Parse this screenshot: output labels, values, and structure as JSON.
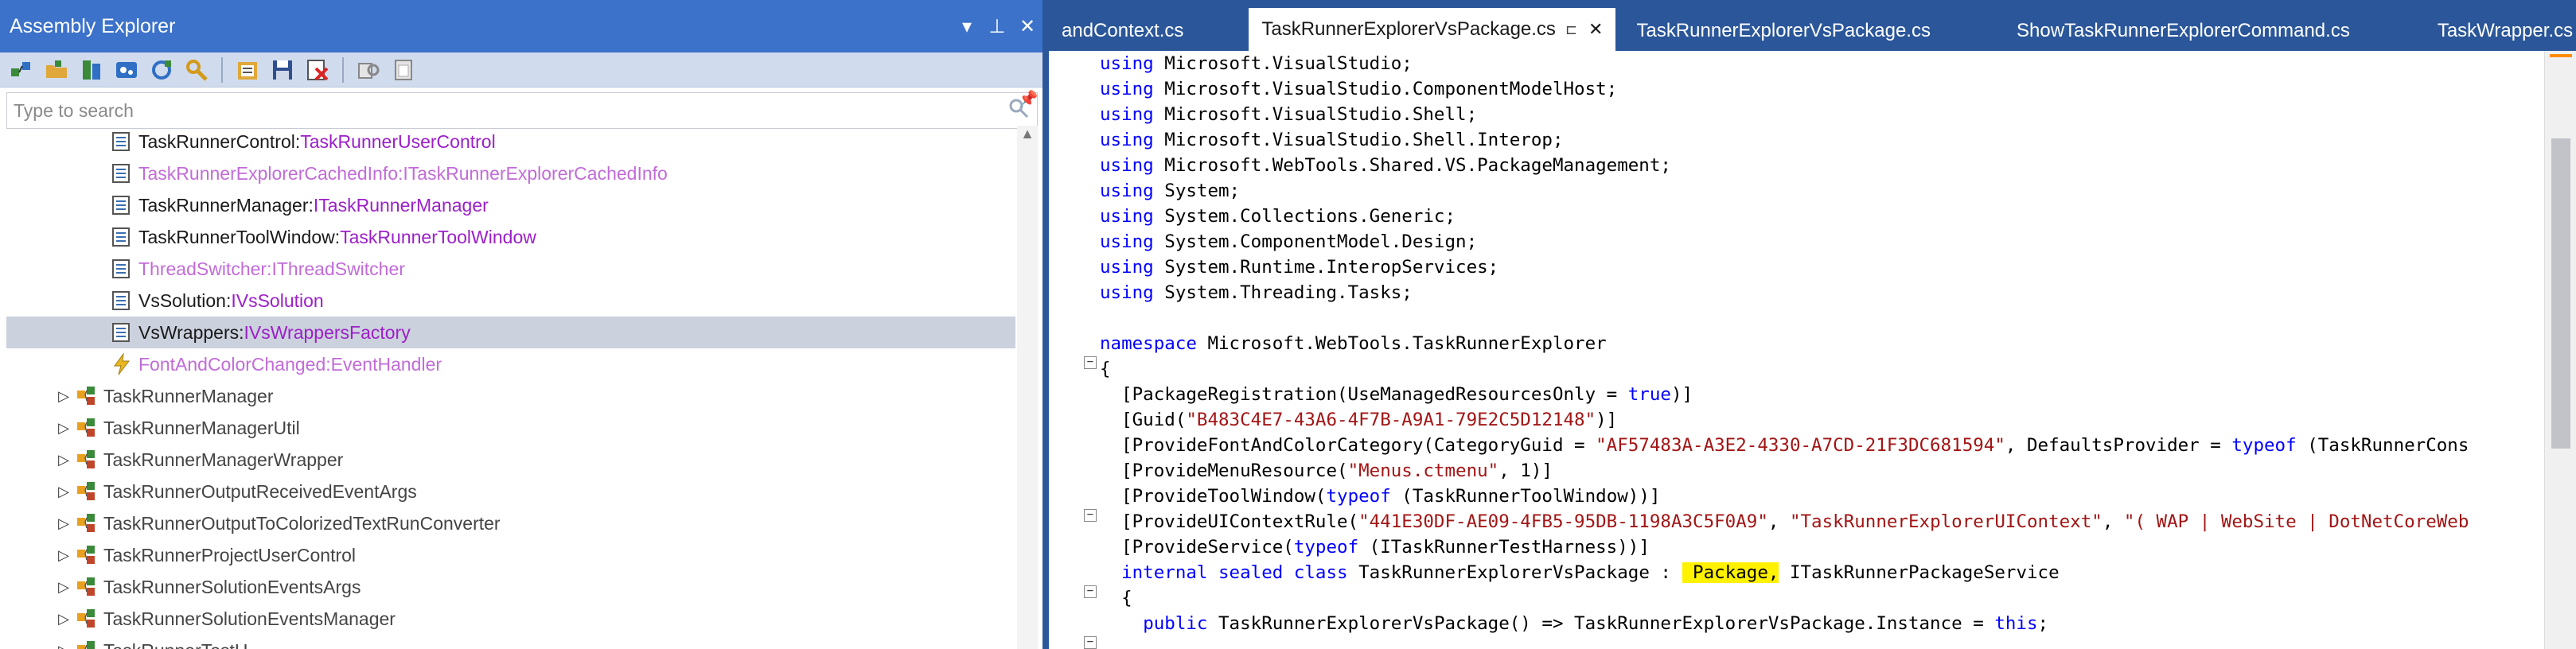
{
  "assembly_explorer": {
    "title": "Assembly Explorer",
    "title_controls": {
      "dropdown": "▾",
      "pin": "⊥",
      "close": "✕"
    },
    "toolbar_icons": [
      "open-assembly-icon",
      "open-folder-icon",
      "open-from-gac-icon",
      "open-nuget-icon",
      "sync-icon",
      "search-icon",
      "new-list-icon",
      "save-list-icon",
      "remove-icon",
      "copy-icon",
      "paste-icon"
    ],
    "search": {
      "placeholder": "Type to search"
    },
    "tree": [
      {
        "name": "TaskRunnerControl",
        "type": "TaskRunnerUserControl",
        "icon": "field-icon",
        "indent": 3,
        "style": "normal"
      },
      {
        "name": "TaskRunnerExplorerCachedInfo",
        "type": "ITaskRunnerExplorerCachedInfo",
        "icon": "field-icon",
        "indent": 3,
        "style": "fade"
      },
      {
        "name": "TaskRunnerManager",
        "type": "ITaskRunnerManager",
        "icon": "field-icon",
        "indent": 3,
        "style": "normal"
      },
      {
        "name": "TaskRunnerToolWindow",
        "type": "TaskRunnerToolWindow",
        "icon": "field-icon",
        "indent": 3,
        "style": "normal"
      },
      {
        "name": "ThreadSwitcher",
        "type": "IThreadSwitcher",
        "icon": "field-icon",
        "indent": 3,
        "style": "fade"
      },
      {
        "name": "VsSolution",
        "type": "IVsSolution",
        "icon": "field-icon",
        "indent": 3,
        "style": "normal"
      },
      {
        "name": "VsWrappers",
        "type": "IVsWrappersFactory",
        "icon": "field-icon",
        "indent": 3,
        "style": "selected"
      },
      {
        "name": "FontAndColorChanged",
        "type": "EventHandler",
        "icon": "event-icon",
        "indent": 3,
        "style": "fade"
      },
      {
        "name": "TaskRunnerManager",
        "type": "",
        "icon": "class-icon",
        "indent": 2,
        "style": "class"
      },
      {
        "name": "TaskRunnerManagerUtil",
        "type": "",
        "icon": "class-icon",
        "indent": 2,
        "style": "class"
      },
      {
        "name": "TaskRunnerManagerWrapper",
        "type": "",
        "icon": "class-icon",
        "indent": 2,
        "style": "class"
      },
      {
        "name": "TaskRunnerOutputReceivedEventArgs",
        "type": "",
        "icon": "class-icon",
        "indent": 2,
        "style": "class"
      },
      {
        "name": "TaskRunnerOutputToColorizedTextRunConverter",
        "type": "",
        "icon": "class-icon",
        "indent": 2,
        "style": "class"
      },
      {
        "name": "TaskRunnerProjectUserControl",
        "type": "",
        "icon": "class-icon",
        "indent": 2,
        "style": "class"
      },
      {
        "name": "TaskRunnerSolutionEventsArgs",
        "type": "",
        "icon": "class-icon",
        "indent": 2,
        "style": "class"
      },
      {
        "name": "TaskRunnerSolutionEventsManager",
        "type": "",
        "icon": "class-icon",
        "indent": 2,
        "style": "class"
      },
      {
        "name": "TaskRunnerTestH...",
        "type": "",
        "icon": "class-icon",
        "indent": 2,
        "style": "class"
      }
    ]
  },
  "editor": {
    "tabs": [
      {
        "label": "andContext.cs",
        "active": false
      },
      {
        "label": "TaskRunnerExplorerVsPackage.cs",
        "active": true,
        "pin": "⊏",
        "close": "✕"
      },
      {
        "label": "TaskRunnerExplorerVsPackage.cs",
        "active": false
      },
      {
        "label": "ShowTaskRunnerExplorerCommand.cs",
        "active": false
      },
      {
        "label": "TaskWrapper.cs",
        "active": false
      }
    ],
    "code_lines": [
      [
        [
          "kw",
          "using"
        ],
        [
          "t",
          " Microsoft.VisualStudio;"
        ]
      ],
      [
        [
          "kw",
          "using"
        ],
        [
          "t",
          " Microsoft.VisualStudio.ComponentModelHost;"
        ]
      ],
      [
        [
          "kw",
          "using"
        ],
        [
          "t",
          " Microsoft.VisualStudio.Shell;"
        ]
      ],
      [
        [
          "kw",
          "using"
        ],
        [
          "t",
          " Microsoft.VisualStudio.Shell.Interop;"
        ]
      ],
      [
        [
          "kw",
          "using"
        ],
        [
          "t",
          " Microsoft.WebTools.Shared.VS.PackageManagement;"
        ]
      ],
      [
        [
          "kw",
          "using"
        ],
        [
          "t",
          " System;"
        ]
      ],
      [
        [
          "kw",
          "using"
        ],
        [
          "t",
          " System.Collections.Generic;"
        ]
      ],
      [
        [
          "kw",
          "using"
        ],
        [
          "t",
          " System.ComponentModel.Design;"
        ]
      ],
      [
        [
          "kw",
          "using"
        ],
        [
          "t",
          " System.Runtime.InteropServices;"
        ]
      ],
      [
        [
          "kw",
          "using"
        ],
        [
          "t",
          " System.Threading.Tasks;"
        ]
      ],
      [],
      [
        [
          "kw",
          "namespace"
        ],
        [
          "t",
          " Microsoft.WebTools.TaskRunnerExplorer"
        ]
      ],
      [
        [
          "t",
          "{"
        ]
      ],
      [
        [
          "t",
          "  [PackageRegistration(UseManagedResourcesOnly = "
        ],
        [
          "kw",
          "true"
        ],
        [
          "t",
          ")]"
        ]
      ],
      [
        [
          "t",
          "  [Guid("
        ],
        [
          "str",
          "\"B483C4E7-43A6-4F7B-A9A1-79E2C5D12148\""
        ],
        [
          "t",
          ")]"
        ]
      ],
      [
        [
          "t",
          "  [ProvideFontAndColorCategory(CategoryGuid = "
        ],
        [
          "str",
          "\"AF57483A-A3E2-4330-A7CD-21F3DC681594\""
        ],
        [
          "t",
          ", DefaultsProvider = "
        ],
        [
          "kw",
          "typeof"
        ],
        [
          "t",
          " (TaskRunnerCons"
        ]
      ],
      [
        [
          "t",
          "  [ProvideMenuResource("
        ],
        [
          "str",
          "\"Menus.ctmenu\""
        ],
        [
          "t",
          ", 1)]"
        ]
      ],
      [
        [
          "t",
          "  [ProvideToolWindow("
        ],
        [
          "kw",
          "typeof"
        ],
        [
          "t",
          " (TaskRunnerToolWindow))]"
        ]
      ],
      [
        [
          "t",
          "  [ProvideUIContextRule("
        ],
        [
          "str",
          "\"441E30DF-AE09-4FB5-95DB-1198A3C5F0A9\""
        ],
        [
          "t",
          ", "
        ],
        [
          "str",
          "\"TaskRunnerExplorerUIContext\""
        ],
        [
          "t",
          ", "
        ],
        [
          "str",
          "\"( WAP | WebSite | DotNetCoreWeb"
        ]
      ],
      [
        [
          "t",
          "  [ProvideService("
        ],
        [
          "kw",
          "typeof"
        ],
        [
          "t",
          " (ITaskRunnerTestHarness))]"
        ]
      ],
      [
        [
          "t",
          "  "
        ],
        [
          "kw",
          "internal sealed class"
        ],
        [
          "t",
          " TaskRunnerExplorerVsPackage : "
        ],
        [
          "hl",
          " Package,"
        ],
        [
          "t",
          " ITaskRunnerPackageService"
        ]
      ],
      [
        [
          "t",
          "  {"
        ]
      ],
      [
        [
          "t",
          "    "
        ],
        [
          "kw",
          "public"
        ],
        [
          "t",
          " TaskRunnerExplorerVsPackage() => TaskRunnerExplorerVsPackage.Instance = "
        ],
        [
          "kw",
          "this"
        ],
        [
          "t",
          ";"
        ]
      ]
    ]
  }
}
